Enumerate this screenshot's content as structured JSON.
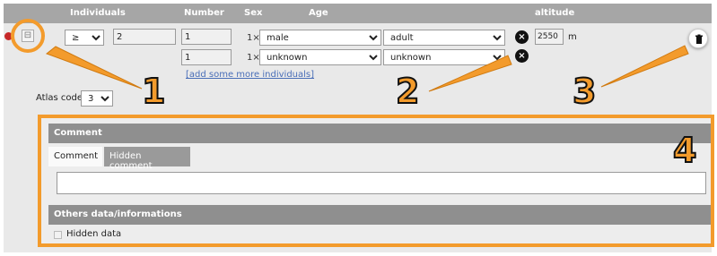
{
  "header": {
    "individuals": "Individuals",
    "number": "Number",
    "sex": "Sex",
    "age": "Age",
    "altitude": "altitude"
  },
  "row1": {
    "operator": "≥",
    "count": "2",
    "number": "1",
    "multiplier": "1×",
    "sex": "male",
    "age": "adult"
  },
  "row2": {
    "number": "1",
    "multiplier": "1×",
    "sex": "unknown",
    "age": "unknown"
  },
  "altitude": {
    "value": "2550",
    "unit": "m"
  },
  "add_individuals_link": "[add some more individuals]",
  "atlas_code": {
    "label": "Atlas code",
    "value": "3"
  },
  "comment_section": {
    "title": "Comment",
    "tabs": [
      "Comment",
      "Hidden comment"
    ]
  },
  "others_section": {
    "title": "Others data/informations",
    "hidden_data_label": "Hidden data"
  },
  "callouts": [
    "1",
    "2",
    "3",
    "4"
  ],
  "colors": {
    "accent": "#f39b2c",
    "header": "#a6a6a6",
    "panel": "#e9e9e9"
  },
  "icons": {
    "collapse": "minus-square-icon",
    "remove": "x-circle-icon",
    "delete": "trash-icon",
    "dropdown": "chevron-down-icon"
  }
}
